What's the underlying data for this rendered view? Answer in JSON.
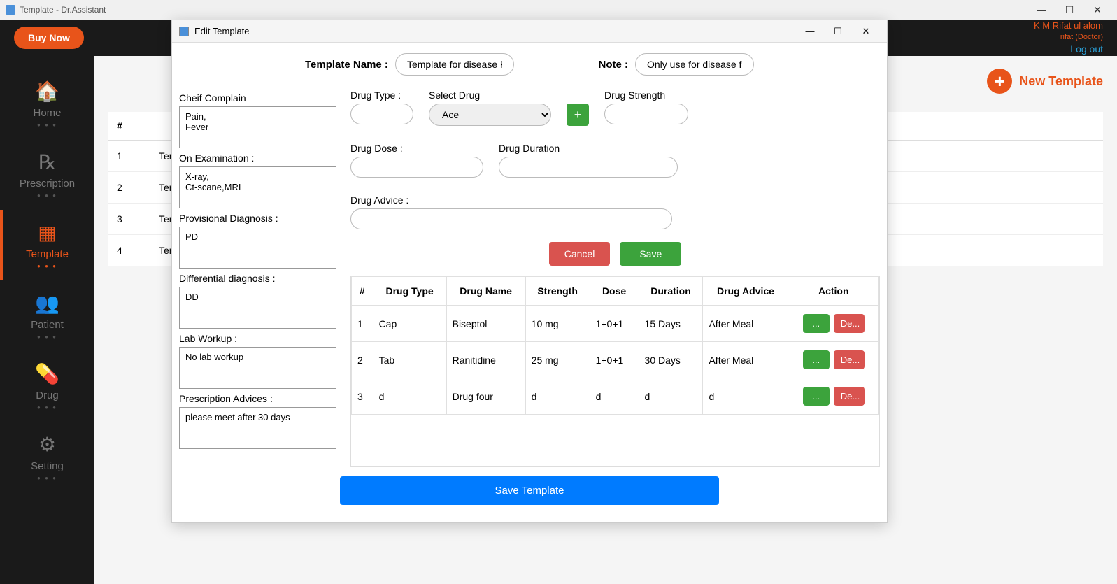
{
  "window_title": "Template - Dr.Assistant",
  "header": {
    "buy_now": "Buy Now",
    "user_name": "K M Rifat ul alom",
    "user_role": "rifat (Doctor)",
    "logout": "Log out"
  },
  "sidebar": {
    "items": [
      {
        "label": "Home",
        "icon": "🏠"
      },
      {
        "label": "Prescription",
        "icon": "℞"
      },
      {
        "label": "Template",
        "icon": "▦"
      },
      {
        "label": "Patient",
        "icon": "👥"
      },
      {
        "label": "Drug",
        "icon": "💊"
      },
      {
        "label": "Setting",
        "icon": "⚙"
      }
    ]
  },
  "content": {
    "new_template_label": "New Template",
    "list_header_num": "#",
    "rows": [
      {
        "num": "1",
        "name": "Tem"
      },
      {
        "num": "2",
        "name": "Tem"
      },
      {
        "num": "3",
        "name": "Tem"
      },
      {
        "num": "4",
        "name": "Tem"
      }
    ]
  },
  "modal": {
    "title": "Edit Template",
    "template_name_label": "Template Name :",
    "template_name_value": "Template for disease Fou",
    "note_label": "Note :",
    "note_value": "Only use for disease four",
    "chief_complain_label": "Cheif Complain",
    "chief_complain_value": "Pain,\nFever",
    "on_exam_label": "On Examination :",
    "on_exam_value": "X-ray,\nCt-scane,MRI",
    "prov_diag_label": "Provisional Diagnosis :",
    "prov_diag_value": "PD",
    "diff_diag_label": "Differential diagnosis :",
    "diff_diag_value": "DD",
    "lab_workup_label": "Lab Workup :",
    "lab_workup_value": "No lab workup",
    "presc_advice_label": "Prescription Advices :",
    "presc_advice_value": "please meet after 30 days",
    "drug_form": {
      "drug_type_label": "Drug Type :",
      "select_drug_label": "Select Drug",
      "select_drug_value": "Ace",
      "drug_strength_label": "Drug Strength",
      "drug_dose_label": "Drug Dose :",
      "drug_duration_label": "Drug Duration",
      "drug_advice_label": "Drug Advice :",
      "add_label": "+"
    },
    "cancel_label": "Cancel",
    "save_label": "Save",
    "table_headers": [
      "#",
      "Drug Type",
      "Drug Name",
      "Strength",
      "Dose",
      "Duration",
      "Drug Advice",
      "Action"
    ],
    "table_rows": [
      {
        "num": "1",
        "type": "Cap",
        "name": "Biseptol",
        "strength": "10 mg",
        "dose": "1+0+1",
        "duration": "15 Days",
        "advice": "After Meal"
      },
      {
        "num": "2",
        "type": "Tab",
        "name": "Ranitidine",
        "strength": "25 mg",
        "dose": "1+0+1",
        "duration": "30 Days",
        "advice": "After Meal"
      },
      {
        "num": "3",
        "type": "d",
        "name": "Drug four",
        "strength": "d",
        "dose": "d",
        "duration": "d",
        "advice": "d"
      }
    ],
    "edit_btn": "...",
    "del_btn": "De...",
    "save_template_label": "Save Template"
  }
}
